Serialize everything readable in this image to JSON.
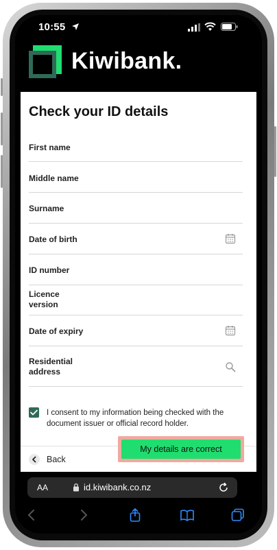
{
  "status_bar": {
    "time": "10:55"
  },
  "brand": {
    "name": "Kiwibank."
  },
  "page": {
    "title": "Check your ID details"
  },
  "fields": [
    {
      "label": "First name",
      "icon": ""
    },
    {
      "label": "Middle name",
      "icon": ""
    },
    {
      "label": "Surname",
      "icon": ""
    },
    {
      "label": "Date of birth",
      "icon": "calendar-icon"
    },
    {
      "label": "ID number",
      "icon": ""
    },
    {
      "label": "Licence version",
      "icon": ""
    },
    {
      "label": "Date of expiry",
      "icon": "calendar-icon"
    },
    {
      "label": "Residential address",
      "icon": "search-icon"
    }
  ],
  "consent": {
    "checked": true,
    "text": "I consent to my information being checked with the document issuer or official record holder."
  },
  "actions": {
    "back_label": "Back",
    "confirm_label": "My details are correct"
  },
  "browser": {
    "aa_label": "AA",
    "url": "id.kiwibank.co.nz"
  },
  "colors": {
    "brand_green": "#1fde6f",
    "checkbox_green": "#2f6a57",
    "highlight": "#f0a99f"
  }
}
